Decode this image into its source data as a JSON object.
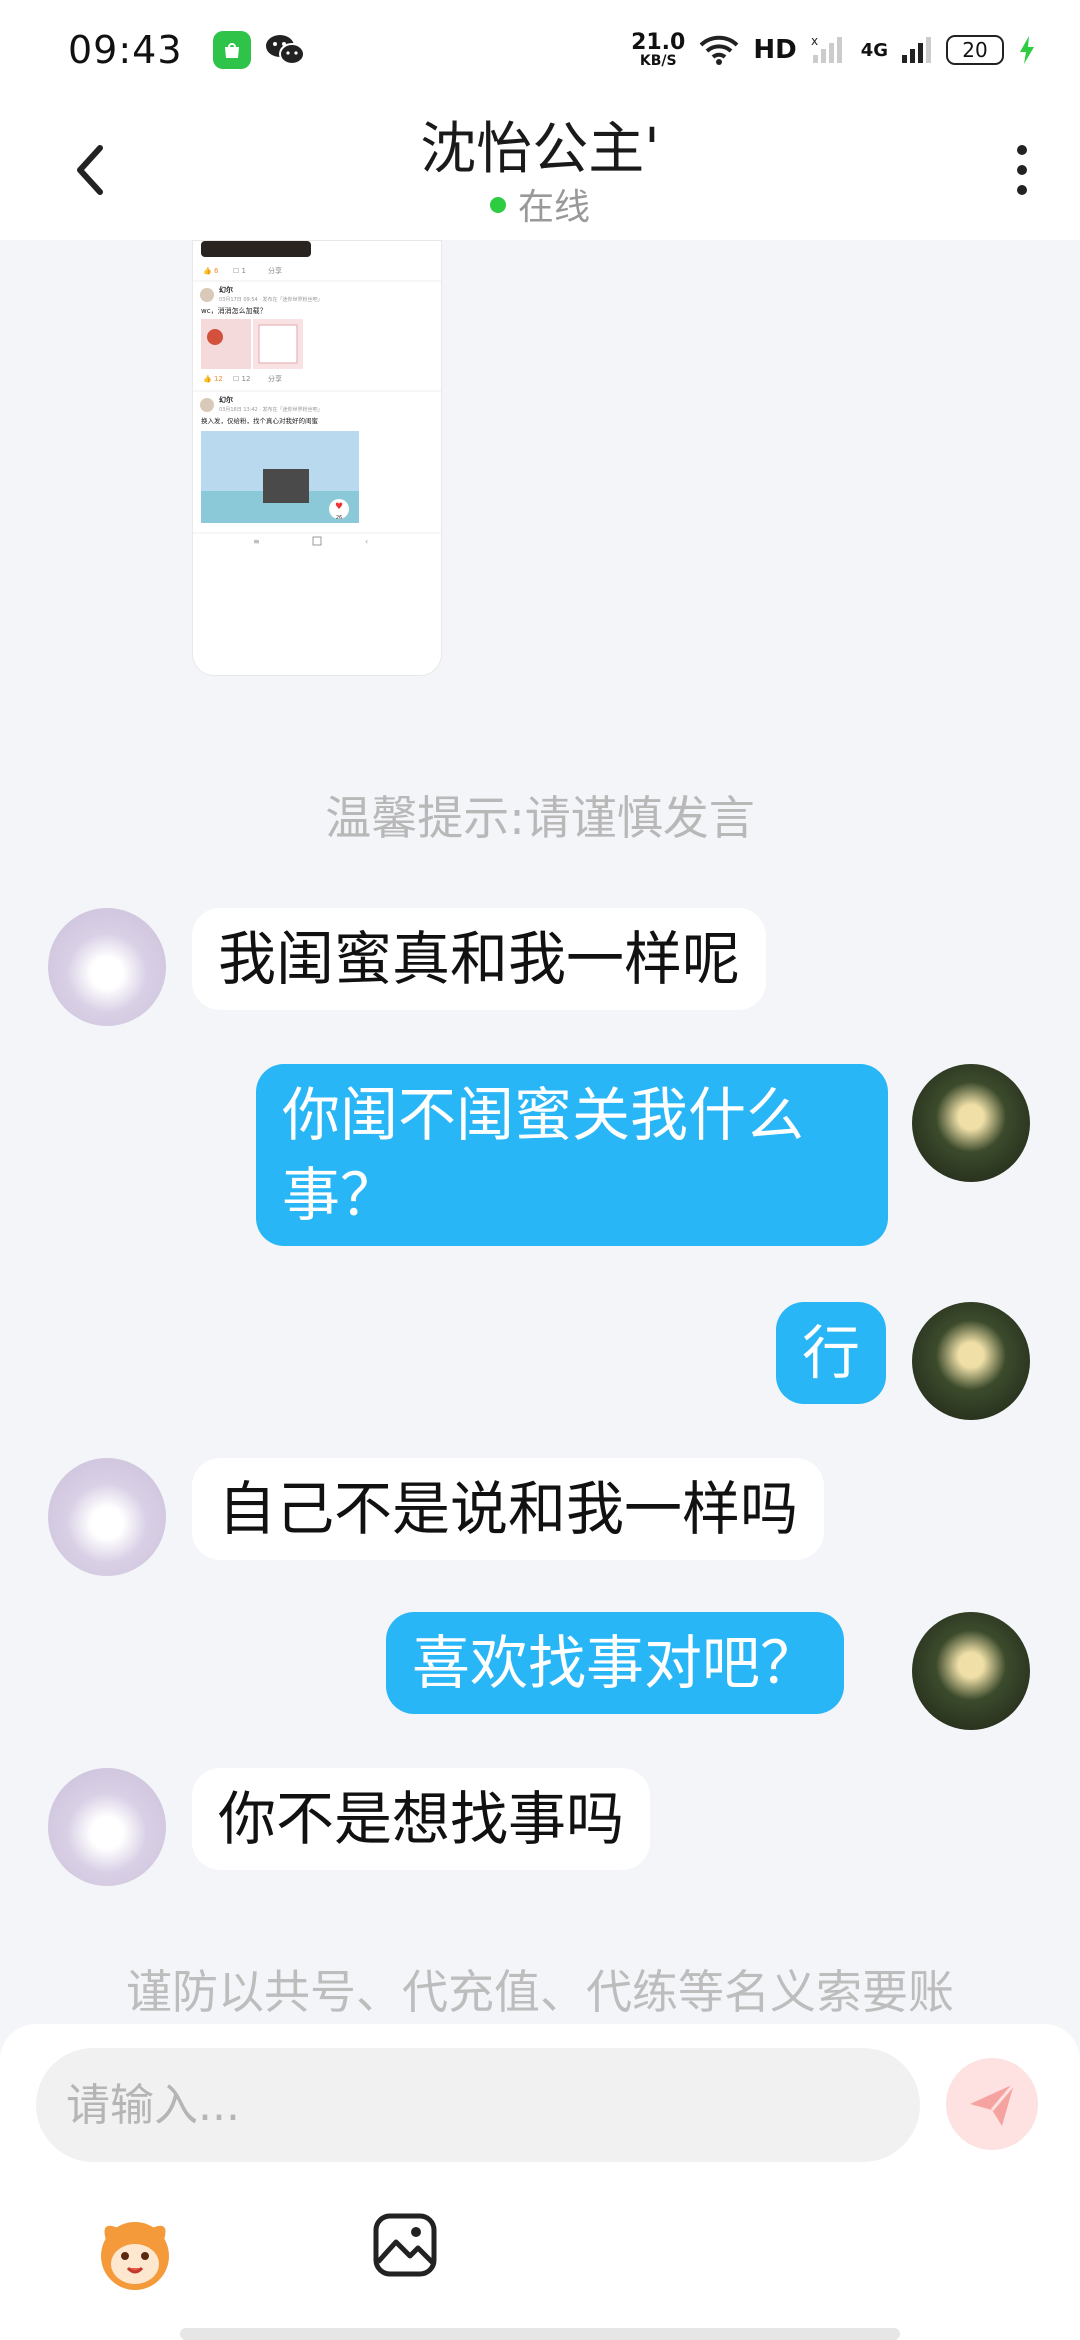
{
  "status_bar": {
    "time": "09:43",
    "net_speed_value": "21.0",
    "net_speed_unit": "KB/S",
    "hd_label": "HD",
    "lte_label": "4G",
    "battery": "20"
  },
  "header": {
    "title": "沈怡公主'",
    "status": "在线"
  },
  "shared_screenshot": {
    "posts": [
      {
        "author": "幻尔",
        "meta": "03月17日 09:54 · 发布在「迷你世界粉丝吧」",
        "text": "wc，消消怎么加载？",
        "likes": "12",
        "comments": "12",
        "share": "分享"
      },
      {
        "author": "幻尔",
        "meta": "03月16日 13:42 · 发布在「迷你世界粉丝吧」",
        "text": "换入发，仅给粉，找个真心对我好的闺蜜",
        "likes": "",
        "comments": "",
        "share": ""
      }
    ],
    "top_likes": "6",
    "top_comments": "1",
    "top_share": "分享",
    "heart_count": "26"
  },
  "tips": {
    "caution": "温馨提示:请谨慎发言",
    "fraud": "谨防以共号、代充值、代练等名义索要账"
  },
  "messages": [
    {
      "side": "in",
      "text": "我闺蜜真和我一样呢"
    },
    {
      "side": "out",
      "text": "你闺不闺蜜关我什么事？"
    },
    {
      "side": "out",
      "text": "行"
    },
    {
      "side": "in",
      "text": "自己不是说和我一样吗"
    },
    {
      "side": "out",
      "text": "喜欢找事对吧？"
    },
    {
      "side": "in",
      "text": "你不是想找事吗"
    }
  ],
  "composer": {
    "placeholder": "请输入..."
  },
  "colors": {
    "outgoing_bubble": "#29b6f6",
    "incoming_bubble": "#ffffff",
    "online": "#2ecc40",
    "send_button": "#f5a3a0"
  }
}
